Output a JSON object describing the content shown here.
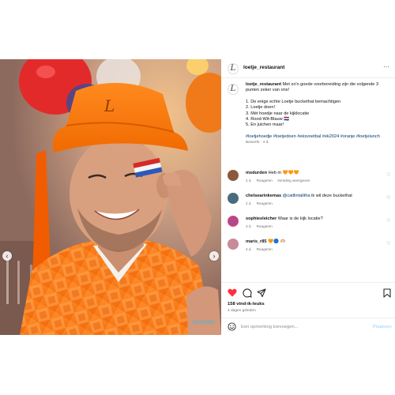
{
  "post": {
    "username": "loetje_restaurant",
    "logo_letter": "L",
    "more_label": "···",
    "caption": {
      "user": "loetje_restaurant",
      "intro": "Met zo'n goede voorbereiding zijn die volgende 3 punten zeker van ons!",
      "list": [
        "1. De enige echte Loetje buckethat bemachtigen",
        "2. Loetje doen!",
        "3. Mèt hoedje naar de kijklocatie",
        "4. Rood-Wit-Blauw 🇳🇱",
        "5. En juichen maar!"
      ],
      "hashtags": "#loetjehoedje #loetjedoen #eksvoetbal #ek2024 #oranje #loetjelunch",
      "meta": "Bewerkt · 4 d."
    },
    "comments": [
      {
        "user": "msdurden",
        "text": "Heb m 🧡🧡🧡",
        "mention": "",
        "time": "2 d.",
        "reply": "Reageren",
        "translate": "Vertaling weergeven",
        "avatar_color": "#8a5a3c"
      },
      {
        "user": "chelsearinkemas",
        "text": " ik wil deze buckethat",
        "mention": "@caitlintalitha",
        "time": "2 d.",
        "reply": "Reageren",
        "translate": "",
        "avatar_color": "#4a6b7d"
      },
      {
        "user": "sophiesleicher",
        "text": "Waar is de kijk locatie?",
        "mention": "",
        "time": "3 d.",
        "reply": "Reageren",
        "translate": "",
        "avatar_color": "#b04a8a"
      },
      {
        "user": "maris_r85",
        "text": "🧡🔵 🫶🏼",
        "mention": "",
        "time": "4 d.",
        "reply": "Reageren",
        "translate": "",
        "avatar_color": "#c98a9a"
      }
    ],
    "likes": "158 vind-ik-leuks",
    "posted": "4 dagen geleden",
    "comment_placeholder": "Een opmerking toevoegen...",
    "post_label": "Plaatsen"
  },
  "icons": {
    "heart_color": "#ff3040",
    "ui_dark": "#262626"
  },
  "carousel": {
    "prev_glyph": "‹",
    "next_glyph": "›"
  }
}
